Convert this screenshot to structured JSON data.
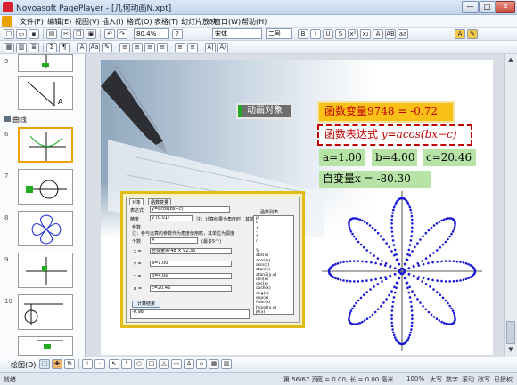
{
  "window": {
    "title": "Novoasoft PagePlayer - [几何动画N.xpt]",
    "controls": [
      "—",
      "□",
      "✕"
    ]
  },
  "menu": {
    "items": [
      "文件(F)",
      "编辑(E)",
      "视图(V)",
      "插入(I)",
      "格式(O)",
      "表格(T)",
      "幻灯片放映",
      "窗口(W)",
      "帮助(H)"
    ]
  },
  "toolbar": {
    "zoom": "80.4%",
    "font": "宋体",
    "size": "二号",
    "icons": [
      "new-icon",
      "open-icon",
      "save-icon",
      "print-icon",
      "cut-icon",
      "copy-icon",
      "paste-icon",
      "undo-icon",
      "redo-icon"
    ],
    "format_buttons": [
      "B",
      "I",
      "U",
      "S",
      "x²",
      "x₂",
      "A",
      "AB",
      "aa"
    ],
    "row2_icons": [
      "Σ",
      "¶",
      "A",
      "Aa",
      "✎",
      "≡",
      "≡",
      "≡",
      "≡",
      "≡",
      "≡",
      "A|",
      "A/"
    ]
  },
  "sidepanel": {
    "section_label": "曲线",
    "thumb_numbers": [
      "5",
      "6",
      "7",
      "8",
      "9",
      "10"
    ]
  },
  "slide": {
    "anim_button": "动画对象",
    "func_var": "函数变量9748 = -0.72",
    "func_expr_prefix": "函数表达式",
    "func_expr_formula": "y=acos(bx−c)",
    "param_a": "a=1.00",
    "param_b": "b=4.00",
    "param_c": "c=20.46",
    "indep_var": "自变量x = -80.30",
    "curve_color": "#1a1ad6"
  },
  "dialog": {
    "tabs": [
      "对象",
      "函数变量"
    ],
    "expr_label": "表达式",
    "expr_value": "y=acos(bx−c)",
    "precision_label": "精度",
    "precision_value": "2 (0.01)",
    "note1": "注：计算结果为角度时，其单位是弧度",
    "params_header": "参数",
    "note2": "注：参与运算的参数作为角度使用时，其单位为弧度",
    "count_label": "个数",
    "count_value": "4",
    "count_hint": "(最多5个)",
    "rows": [
      {
        "name": "x =",
        "value": "自变量9748 × 92.35"
      },
      {
        "name": "y =",
        "value": "a=1.00"
      },
      {
        "name": "z =",
        "value": "b=4.00"
      },
      {
        "name": "u =",
        "value": "c=20.46"
      }
    ],
    "calc_button": "计算结果",
    "result": "-0.98",
    "func_list_title": "函数列表",
    "functions": [
      "pi",
      "e",
      "+",
      "-",
      "*",
      "/",
      "^",
      "%",
      "abs(x)",
      "acos(x)",
      "asin(x)",
      "atan(x)",
      "atan2(y,x)",
      "ceil(x)",
      "cos(x)",
      "cosh(x)",
      "deg(x)",
      "exp(x)",
      "floor(x)",
      "hypot(x,y)",
      "j0(x)"
    ]
  },
  "drawbar": {
    "label": "绘图(D)",
    "tools": [
      "↖",
      "\\",
      "○",
      "□",
      "△",
      "▭",
      "A",
      "⌂",
      "▦",
      "▥"
    ]
  },
  "status": {
    "ready": "就绪",
    "page": "第 56/67 页",
    "width": "宽 = 0.00, 长 = 0.00 毫米",
    "zoom": "100%",
    "modes": [
      "大写",
      "数字",
      "滚动",
      "改写",
      "已授权"
    ]
  }
}
